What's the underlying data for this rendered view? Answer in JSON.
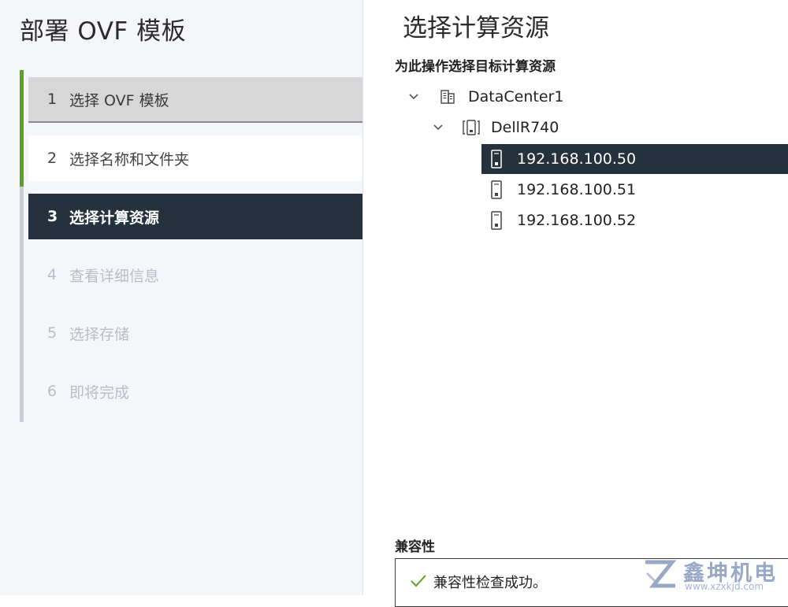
{
  "wizard": {
    "title": "部署 OVF 模板",
    "steps": [
      {
        "num": "1",
        "label": "选择 OVF 模板",
        "state": "done"
      },
      {
        "num": "2",
        "label": "选择名称和文件夹",
        "state": "visited"
      },
      {
        "num": "3",
        "label": "选择计算资源",
        "state": "current"
      },
      {
        "num": "4",
        "label": "查看详细信息",
        "state": "future"
      },
      {
        "num": "5",
        "label": "选择存储",
        "state": "future"
      },
      {
        "num": "6",
        "label": "即将完成",
        "state": "future"
      }
    ]
  },
  "main": {
    "title": "选择计算资源",
    "subtitle": "为此操作选择目标计算资源",
    "tree": {
      "datacenter": {
        "label": "DataCenter1",
        "icon": "datacenter-icon"
      },
      "cluster": {
        "label": "DellR740",
        "icon": "cluster-icon"
      },
      "hosts": [
        {
          "label": "192.168.100.50",
          "icon": "host-icon",
          "selected": true
        },
        {
          "label": "192.168.100.51",
          "icon": "host-icon",
          "selected": false
        },
        {
          "label": "192.168.100.52",
          "icon": "host-icon",
          "selected": false
        }
      ]
    },
    "compatibility": {
      "label": "兼容性",
      "message": "兼容性检查成功。",
      "icon": "check-icon"
    }
  },
  "watermark": {
    "name": "鑫坤机电",
    "url": "www.xzxkjd.com"
  },
  "colors": {
    "accent_green": "#5aa220",
    "selected_bg": "#25313d",
    "check_green": "#5aa220"
  }
}
